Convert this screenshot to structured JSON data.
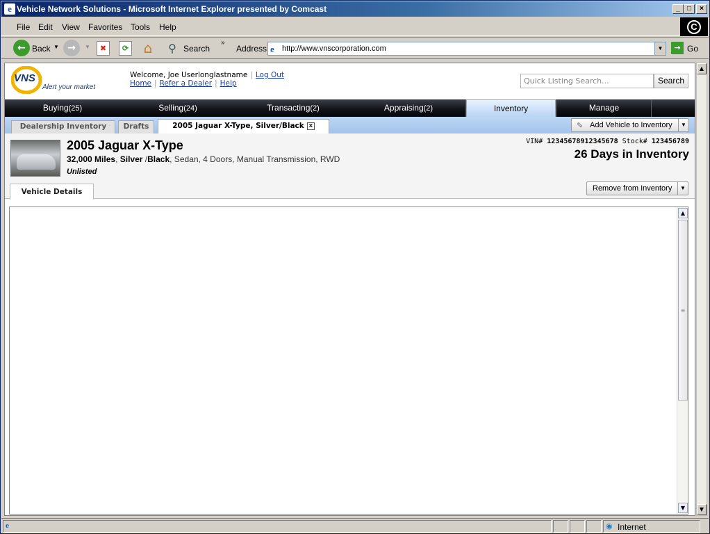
{
  "window": {
    "title": "Vehicle Network Solutions - Microsoft Internet Explorer presented by Comcast"
  },
  "menu": [
    "File",
    "Edit",
    "View",
    "Favorites",
    "Tools",
    "Help"
  ],
  "toolbar": {
    "back": "Back",
    "search": "Search",
    "address_label": "Address",
    "url": "http://www.vnscorporation.com",
    "go": "Go"
  },
  "header": {
    "logo_text": "VNS",
    "tagline": "Alert your market",
    "welcome": "Welcome, Joe Userlonglastname",
    "logout": "Log Out",
    "links": [
      "Home",
      "Refer a Dealer",
      "Help"
    ],
    "search_placeholder": "Quick Listing Search...",
    "search_button": "Search"
  },
  "nav": [
    {
      "label": "Buying",
      "count": "(25)"
    },
    {
      "label": "Selling",
      "count": "(24)"
    },
    {
      "label": "Transacting",
      "count": "(2)"
    },
    {
      "label": "Appraising",
      "count": "(2)"
    },
    {
      "label": "Inventory",
      "count": ""
    },
    {
      "label": "Manage",
      "count": ""
    }
  ],
  "subtabs": [
    "Dealership Inventory",
    "Drafts",
    "2005 Jaguar X-Type, Silver/Black"
  ],
  "add_vehicle": "Add Vehicle to Inventory",
  "vehicle": {
    "title": "2005 Jaguar X-Type",
    "miles": "32,000 Miles",
    "color_ext": "Silver",
    "color_int": "Black",
    "specs": ", Sedan, 4 Doors, Manual Transmission, RWD",
    "status": "Unlisted",
    "vin_label": "VIN#",
    "vin": "12345678912345678",
    "stock_label": "Stock#",
    "stock": "123456789",
    "days": "26 Days in Inventory"
  },
  "detail_tab": "Vehicle Details",
  "remove_button": "Remove from Inventory",
  "status": {
    "zone": "Internet"
  }
}
